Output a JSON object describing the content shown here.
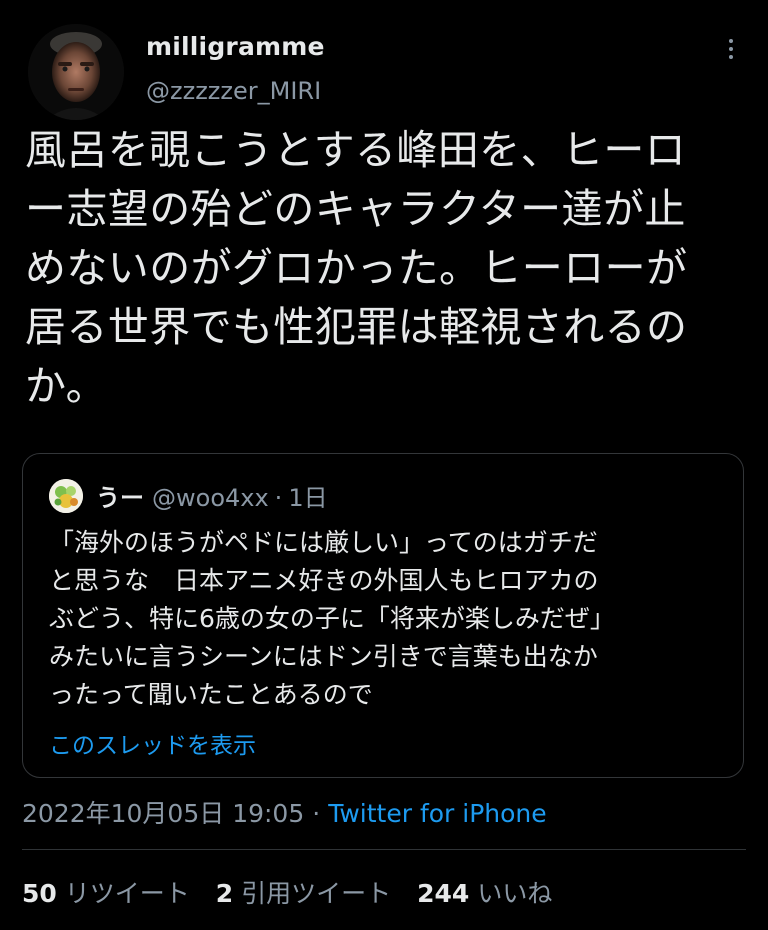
{
  "tweet": {
    "author_name": "milligramme",
    "author_handle": "@zzzzzer_MIRI",
    "text": "風呂を覗こうとする峰田を、ヒーロ\nー志望の殆どのキャラクター達が止\nめないのがグロかった。ヒーローが\n居る世界でも性犯罪は軽視されるの\nか。",
    "timestamp": "2022年10月05日 19:05",
    "separator": "·",
    "source": "Twitter for iPhone"
  },
  "quote": {
    "name": "うー",
    "handle": "@woo4xx",
    "separator": "·",
    "time": "1日",
    "text": "「海外のほうがペドには厳しい」ってのはガチだ\nと思うな　日本アニメ好きの外国人もヒロアカの\nぶどう、特に6歳の女の子に「将来が楽しみだぜ」\nみたいに言うシーンにはドン引きで言葉も出なか\nったって聞いたことあるので",
    "show_thread": "このスレッドを表示"
  },
  "stats": {
    "retweets": {
      "count": "50",
      "label": "リツイート"
    },
    "quotes": {
      "count": "2",
      "label": "引用ツイート"
    },
    "likes": {
      "count": "244",
      "label": "いいね"
    }
  },
  "icons": {
    "more": "more-horizontal-icon",
    "avatar": "user-avatar",
    "quote_avatar": "quote-user-avatar"
  },
  "colors": {
    "background": "#000000",
    "text": "#e7e9ea",
    "muted": "#8b98a5",
    "link": "#1d9bf0",
    "border": "#333639"
  }
}
